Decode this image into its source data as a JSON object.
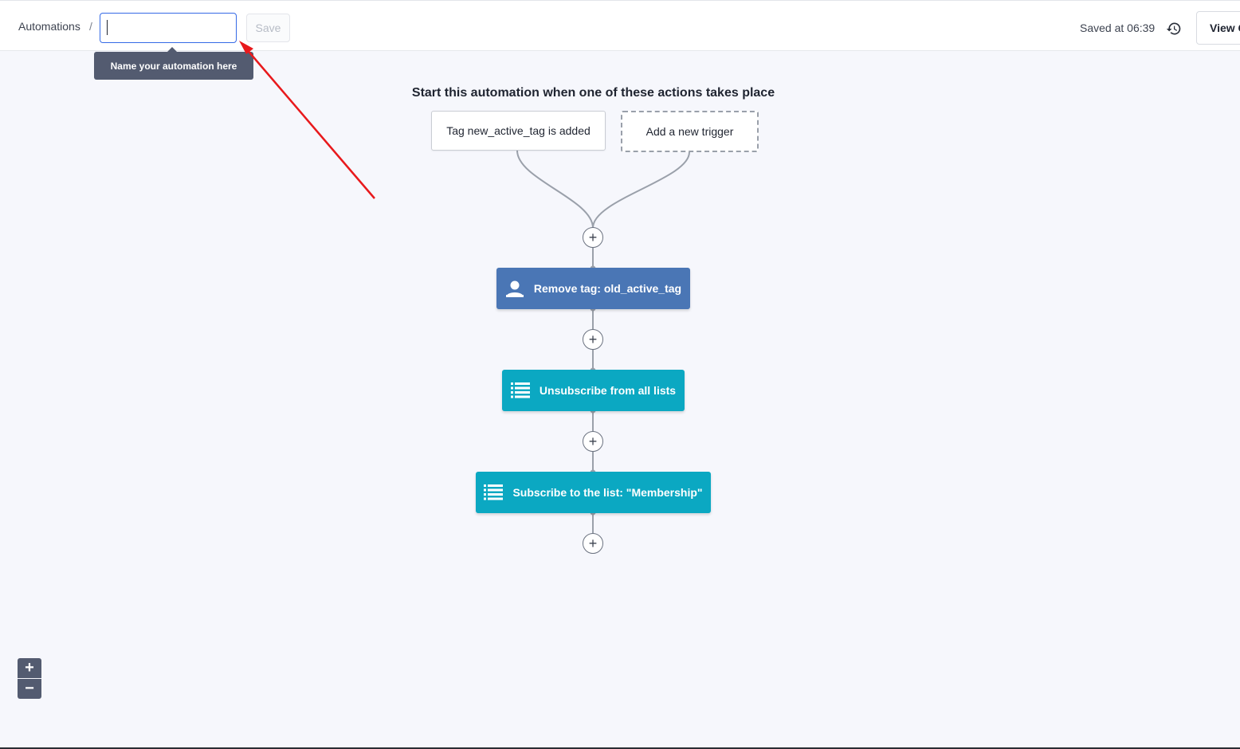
{
  "header": {
    "breadcrumb": "Automations",
    "separator": "/",
    "name_input_value": "",
    "save_label": "Save",
    "saved_status": "Saved at 06:39",
    "view_button_label": "View C"
  },
  "tooltip": {
    "text": "Name your automation here"
  },
  "flow": {
    "heading": "Start this automation when one of these actions takes place",
    "triggers": [
      {
        "label": "Tag new_active_tag is added"
      }
    ],
    "add_trigger_label": "Add a new trigger",
    "actions": [
      {
        "label": "Remove tag: old_active_tag",
        "icon": "person-icon",
        "color": "#4a76b5"
      },
      {
        "label": "Unsubscribe from all lists",
        "icon": "list-icon",
        "color": "#0ba8c2"
      },
      {
        "label": "Subscribe to the list: \"Membership\"",
        "icon": "list-icon",
        "color": "#0ba8c2"
      }
    ],
    "plus_symbol": "+"
  },
  "zoom": {
    "in_symbol": "+",
    "out_symbol": "−"
  },
  "colors": {
    "accent_input_border": "#356ae6",
    "annotation_arrow": "#e8191c"
  }
}
